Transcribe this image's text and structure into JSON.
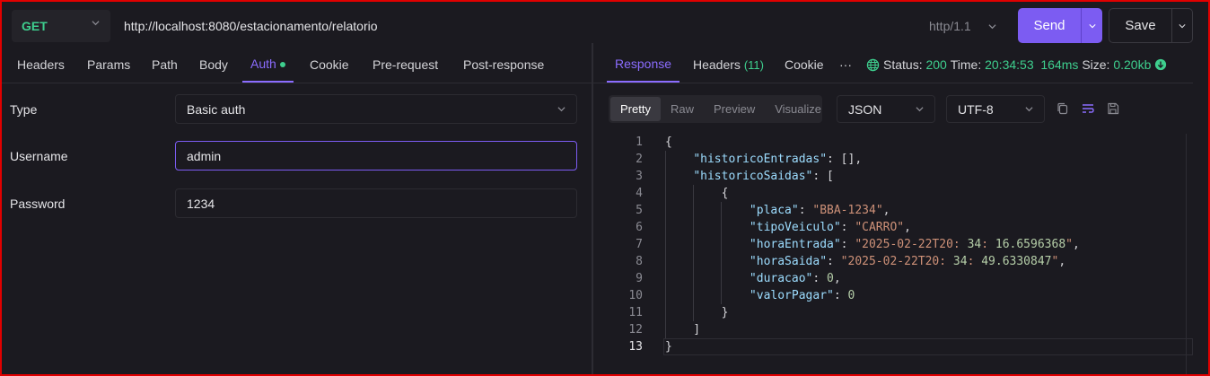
{
  "request": {
    "method": "GET",
    "url": "http://localhost:8080/estacionamento/relatorio",
    "http_version": "http/1.1",
    "send_label": "Send",
    "save_label": "Save"
  },
  "request_tabs": [
    "Headers",
    "Params",
    "Path",
    "Body",
    "Auth",
    "Cookie",
    "Pre-request",
    "Post-response"
  ],
  "active_request_tab": "Auth",
  "auth": {
    "type_label": "Type",
    "type_value": "Basic auth",
    "username_label": "Username",
    "username_value": "admin",
    "password_label": "Password",
    "password_value": "1234"
  },
  "response_tabs": {
    "response": "Response",
    "headers": "Headers",
    "headers_count": "(11)",
    "cookie": "Cookie",
    "more": "···"
  },
  "response_status": {
    "status_label": "Status:",
    "status_code": "200",
    "time_label": "Time:",
    "time_value": "20:34:53",
    "duration": "164ms",
    "size_label": "Size:",
    "size_value": "0.20kb"
  },
  "view_modes": [
    "Pretty",
    "Raw",
    "Preview",
    "Visualize"
  ],
  "active_view_mode": "Pretty",
  "format": "JSON",
  "encoding": "UTF-8",
  "colors": {
    "accent": "#7c5cf2",
    "success": "#3ecf8e",
    "error_frame": "#e00000"
  },
  "response_body_lines": [
    "{",
    "    \"historicoEntradas\": [],",
    "    \"historicoSaidas\": [",
    "        {",
    "            \"placa\": \"BBA-1234\",",
    "            \"tipoVeiculo\": \"CARRO\",",
    "            \"horaEntrada\": \"2025-02-22T20:34:16.6596368\",",
    "            \"horaSaida\": \"2025-02-22T20:34:49.6330847\",",
    "            \"duracao\": 0,",
    "            \"valorPagar\": 0",
    "        }",
    "    ]",
    "}"
  ]
}
